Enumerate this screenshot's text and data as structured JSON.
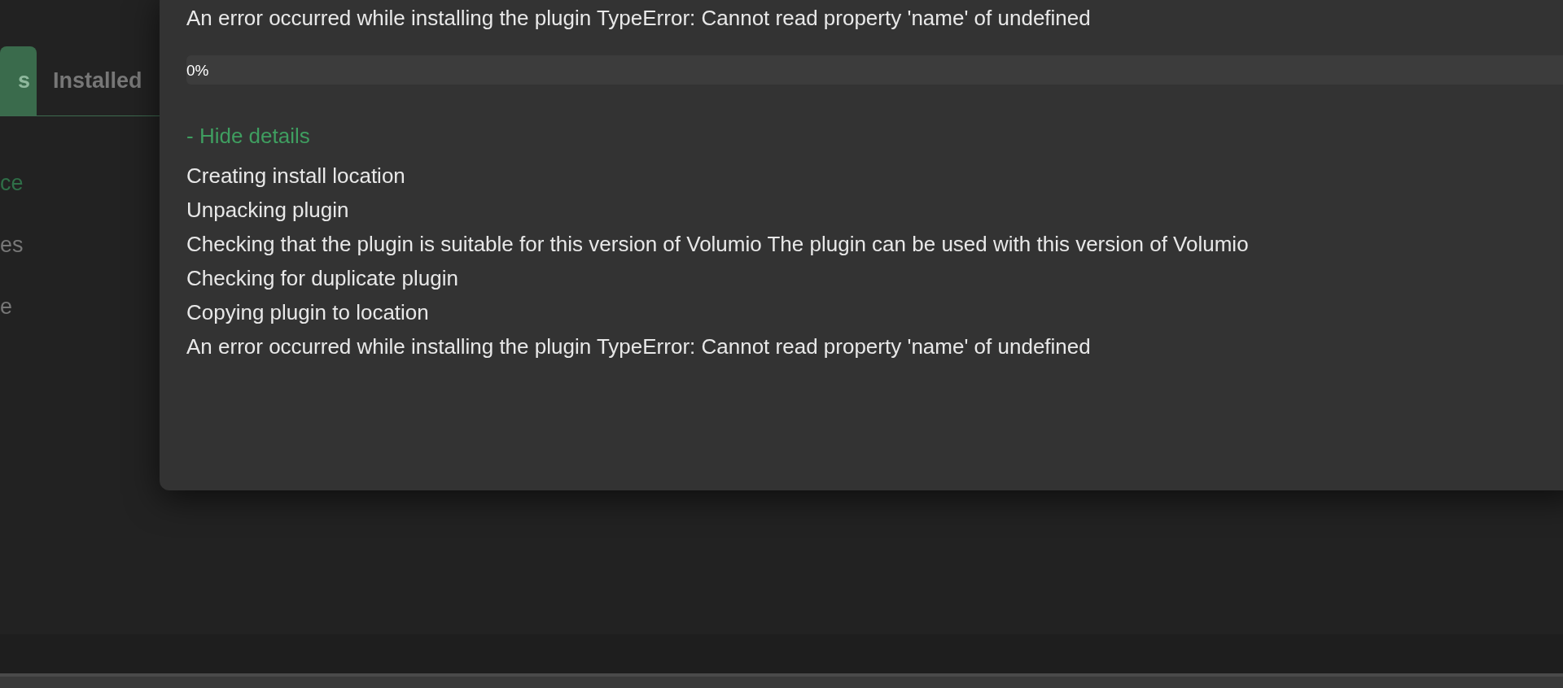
{
  "background": {
    "tabs": [
      {
        "label": "s",
        "selected": true
      },
      {
        "label": "Installed",
        "selected": false
      }
    ],
    "sidebar_items": [
      {
        "label": "ce",
        "selected": true
      },
      {
        "label": "es",
        "selected": false
      },
      {
        "label": "e",
        "selected": false
      }
    ]
  },
  "dialog": {
    "message": "An error occurred while installing the plugin TypeError: Cannot read property 'name' of undefined",
    "progress": {
      "level": 0,
      "label": "0%"
    },
    "details_toggle": "- Hide details",
    "log_lines": [
      "Creating install location",
      "Unpacking plugin",
      "Checking that the plugin is suitable for this version of Volumio The plugin can be used with this version of Volumio",
      "Checking for duplicate plugin",
      "Copying plugin to location",
      "An error occurred while installing the plugin TypeError: Cannot read property 'name' of undefined"
    ]
  }
}
